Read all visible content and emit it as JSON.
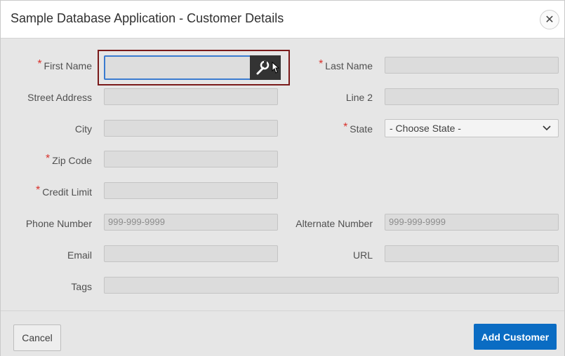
{
  "dialog": {
    "title": "Sample Database Application - Customer Details",
    "close_icon": "close-icon"
  },
  "form": {
    "first_name": {
      "label": "First Name",
      "required": "*",
      "value": ""
    },
    "last_name": {
      "label": "Last Name",
      "required": "*",
      "value": ""
    },
    "street_address": {
      "label": "Street Address",
      "value": ""
    },
    "line2": {
      "label": "Line 2",
      "value": ""
    },
    "city": {
      "label": "City",
      "value": ""
    },
    "state": {
      "label": "State",
      "required": "*",
      "selected": "- Choose State -"
    },
    "zip_code": {
      "label": "Zip Code",
      "required": "*",
      "value": ""
    },
    "credit_limit": {
      "label": "Credit Limit",
      "required": "*",
      "value": ""
    },
    "phone_number": {
      "label": "Phone Number",
      "placeholder": "999-999-9999"
    },
    "alternate_number": {
      "label": "Alternate Number",
      "placeholder": "999-999-9999"
    },
    "email": {
      "label": "Email",
      "value": ""
    },
    "url": {
      "label": "URL",
      "value": ""
    },
    "tags": {
      "label": "Tags",
      "value": ""
    }
  },
  "footer": {
    "cancel_label": "Cancel",
    "add_label": "Add Customer"
  },
  "colors": {
    "primary": "#0a6cc3",
    "required": "#d9322c",
    "focus_ring": "#7a1a1a"
  }
}
